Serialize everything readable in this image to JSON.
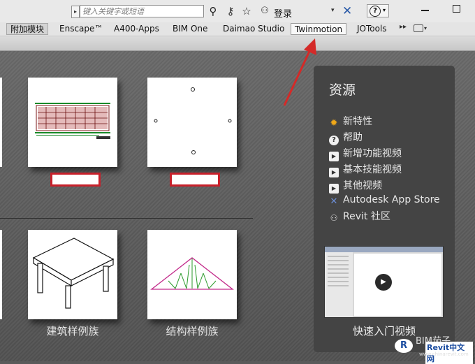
{
  "toolbar": {
    "search_placeholder": "键入关键字或短语",
    "login_label": "登录"
  },
  "tabs": [
    {
      "label": "附加模块"
    },
    {
      "label": "Enscape™"
    },
    {
      "label": "A400-Apps"
    },
    {
      "label": "BIM One"
    },
    {
      "label": "Daimao Studio"
    },
    {
      "label": "Twinmotion"
    },
    {
      "label": "JOTools"
    }
  ],
  "cards": {
    "bottom_left_label": "建筑样例族",
    "bottom_right_label": "结构样例族"
  },
  "resources": {
    "title": "资源",
    "items": [
      {
        "label": "新特性",
        "icon": "sun-icon"
      },
      {
        "label": "帮助",
        "icon": "help-icon"
      },
      {
        "label": "新增功能视频",
        "icon": "play-icon"
      },
      {
        "label": "基本技能视频",
        "icon": "play-icon"
      },
      {
        "label": "其他视频",
        "icon": "play-icon"
      },
      {
        "label": "Autodesk App Store",
        "icon": "autodesk-x-icon"
      },
      {
        "label": "Revit 社区",
        "icon": "people-icon"
      }
    ],
    "video_caption": "快速入门视频"
  },
  "watermark": {
    "bim": "BIM茄子",
    "brand": "Revit中文网",
    "url": "www.chinarevit.com"
  },
  "colors": {
    "annotation_arrow": "#d42a28",
    "card_highlight_border": "#c8202a",
    "panel_bg": "#444444"
  }
}
